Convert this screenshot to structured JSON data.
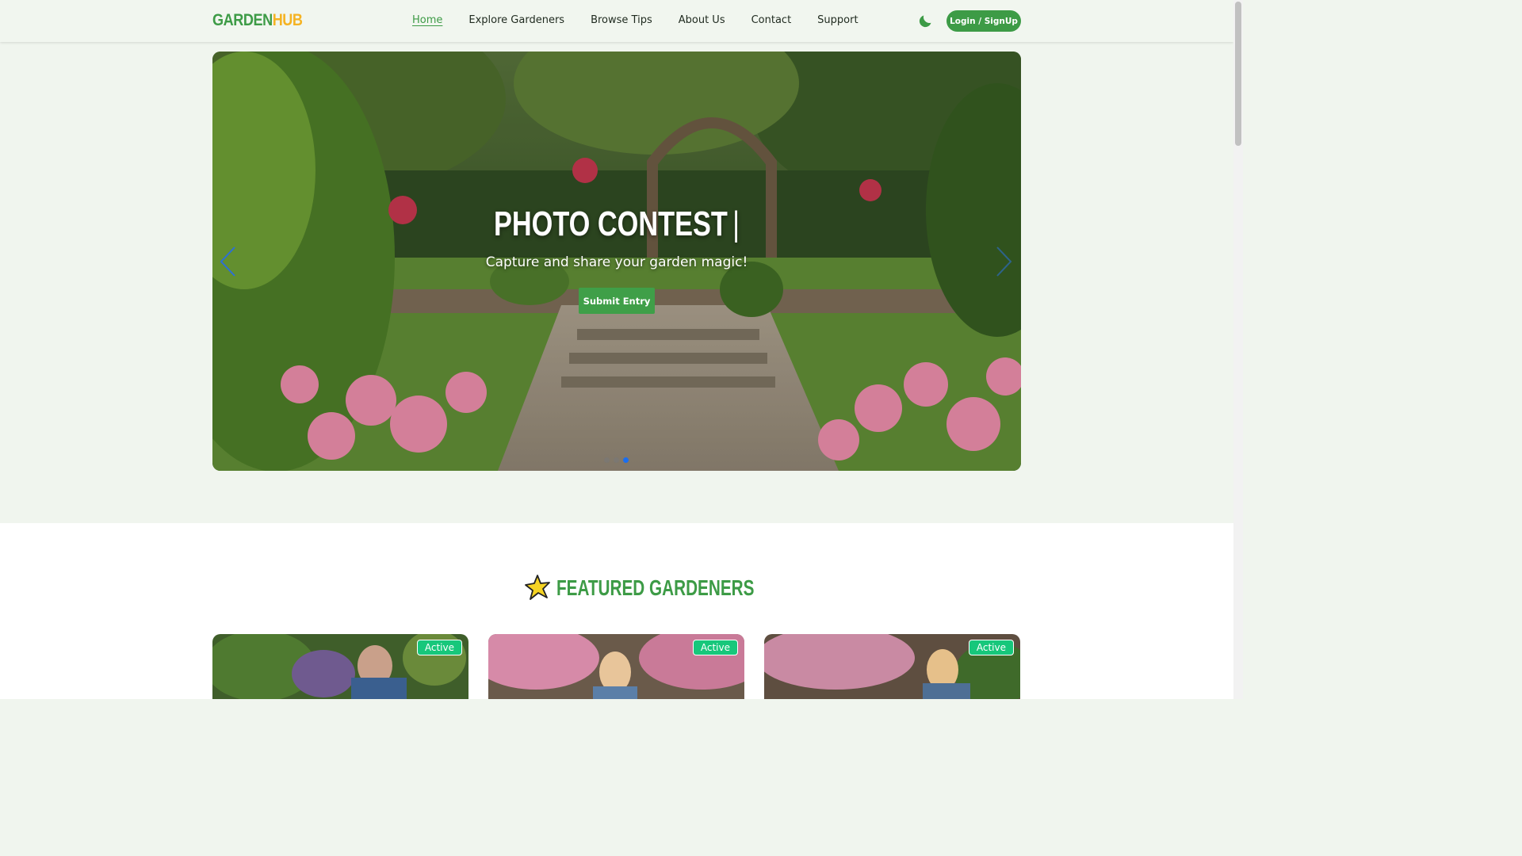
{
  "header": {
    "logo_part1": "GARDEN",
    "logo_part2": "HUB",
    "nav": [
      {
        "label": "Home",
        "active": true
      },
      {
        "label": "Explore Gardeners"
      },
      {
        "label": "Browse Tips"
      },
      {
        "label": "About Us"
      },
      {
        "label": "Contact"
      },
      {
        "label": "Support"
      }
    ],
    "theme_icon": "moon-icon",
    "login_label": "Login / SignUp"
  },
  "hero": {
    "title": "PHOTO CONTEST",
    "cursor": "|",
    "subtitle": "Capture and share your garden magic!",
    "button_label": "Submit Entry",
    "slide_count": 3,
    "active_slide": 3
  },
  "featured": {
    "title": "FEATURED GARDENERS",
    "cards": [
      {
        "badge": "Active"
      },
      {
        "badge": "Active"
      },
      {
        "badge": "Active"
      }
    ]
  },
  "colors": {
    "brand_green": "#3d9b46",
    "brand_yellow": "#f5b323",
    "badge_green": "#17c77b",
    "dot_active": "#1a6ef0"
  }
}
